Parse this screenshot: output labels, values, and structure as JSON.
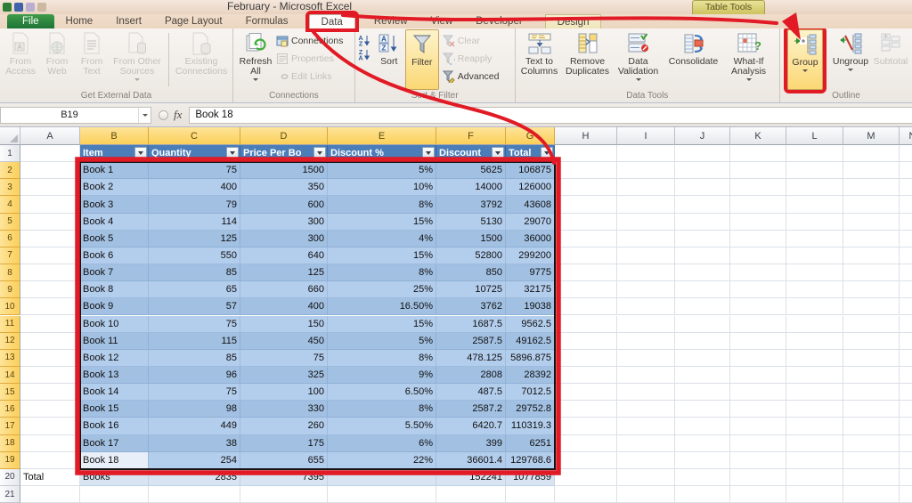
{
  "titlebar": {
    "title": "February - Microsoft Excel",
    "context_badge": "Table Tools"
  },
  "tabs": {
    "file": "File",
    "home": "Home",
    "insert": "Insert",
    "page_layout": "Page Layout",
    "formulas": "Formulas",
    "data": "Data",
    "review": "Review",
    "view": "View",
    "developer": "Developer",
    "design": "Design",
    "active_tab": "Data"
  },
  "ribbon": {
    "get_external_data": {
      "label": "Get External Data",
      "from_access": "From\nAccess",
      "from_web": "From\nWeb",
      "from_text": "From\nText",
      "from_other_sources": "From Other\nSources",
      "existing_connections": "Existing\nConnections"
    },
    "connections": {
      "label": "Connections",
      "refresh_all": "Refresh\nAll",
      "connections": "Connections",
      "properties": "Properties",
      "edit_links": "Edit Links"
    },
    "sort_filter": {
      "label": "Sort & Filter",
      "sort": "Sort",
      "filter": "Filter",
      "clear": "Clear",
      "reapply": "Reapply",
      "advanced": "Advanced"
    },
    "data_tools": {
      "label": "Data Tools",
      "text_to_columns": "Text to\nColumns",
      "remove_duplicates": "Remove\nDuplicates",
      "data_validation": "Data\nValidation",
      "consolidate": "Consolidate",
      "what_if_analysis": "What-If\nAnalysis"
    },
    "outline": {
      "label": "Outline",
      "group": "Group",
      "ungroup": "Ungroup",
      "subtotal": "Subtotal"
    }
  },
  "formula_bar": {
    "name_box": "B19",
    "fx": "fx",
    "formula": "Book 18"
  },
  "sheet": {
    "columns": [
      "A",
      "B",
      "C",
      "D",
      "E",
      "F",
      "G",
      "H",
      "I",
      "J",
      "K",
      "L",
      "M",
      "N"
    ],
    "rows_visible": 21,
    "selected_columns": "B:G",
    "selected_rows": "2:19",
    "active_cell": "B19",
    "table": {
      "headers": [
        "Item",
        "Quantity",
        "Price Per Bo",
        "Discount %",
        "Discount",
        "Total"
      ],
      "rows": [
        [
          "Book 1",
          "75",
          "1500",
          "5%",
          "5625",
          "106875"
        ],
        [
          "Book 2",
          "400",
          "350",
          "10%",
          "14000",
          "126000"
        ],
        [
          "Book 3",
          "79",
          "600",
          "8%",
          "3792",
          "43608"
        ],
        [
          "Book 4",
          "114",
          "300",
          "15%",
          "5130",
          "29070"
        ],
        [
          "Book 5",
          "125",
          "300",
          "4%",
          "1500",
          "36000"
        ],
        [
          "Book 6",
          "550",
          "640",
          "15%",
          "52800",
          "299200"
        ],
        [
          "Book 7",
          "85",
          "125",
          "8%",
          "850",
          "9775"
        ],
        [
          "Book 8",
          "65",
          "660",
          "25%",
          "10725",
          "32175"
        ],
        [
          "Book 9",
          "57",
          "400",
          "16.50%",
          "3762",
          "19038"
        ],
        [
          "Book 10",
          "75",
          "150",
          "15%",
          "1687.5",
          "9562.5"
        ],
        [
          "Book 11",
          "115",
          "450",
          "5%",
          "2587.5",
          "49162.5"
        ],
        [
          "Book 12",
          "85",
          "75",
          "8%",
          "478.125",
          "5896.875"
        ],
        [
          "Book 13",
          "96",
          "325",
          "9%",
          "2808",
          "28392"
        ],
        [
          "Book 14",
          "75",
          "100",
          "6.50%",
          "487.5",
          "7012.5"
        ],
        [
          "Book 15",
          "98",
          "330",
          "8%",
          "2587.2",
          "29752.8"
        ],
        [
          "Book 16",
          "449",
          "260",
          "5.50%",
          "6420.7",
          "110319.3"
        ],
        [
          "Book 17",
          "38",
          "175",
          "6%",
          "399",
          "6251"
        ],
        [
          "Book 18",
          "254",
          "655",
          "22%",
          "36601.4",
          "129768.6"
        ]
      ],
      "total_label_col_a": "Total",
      "total_row": [
        "Books",
        "2835",
        "7395",
        "",
        "152241",
        "1077859"
      ]
    }
  },
  "colors": {
    "annotation_red": "#e11a25",
    "table_header_blue": "#4b7db8",
    "selected_header_gold": "#fbcf58",
    "row_band_dark": "#a2c0e2",
    "row_band_light": "#b3cdec",
    "total_row_blue": "#d8e4f2",
    "highlight_yellow": "#fbd875",
    "file_tab_green": "#1f7334"
  }
}
